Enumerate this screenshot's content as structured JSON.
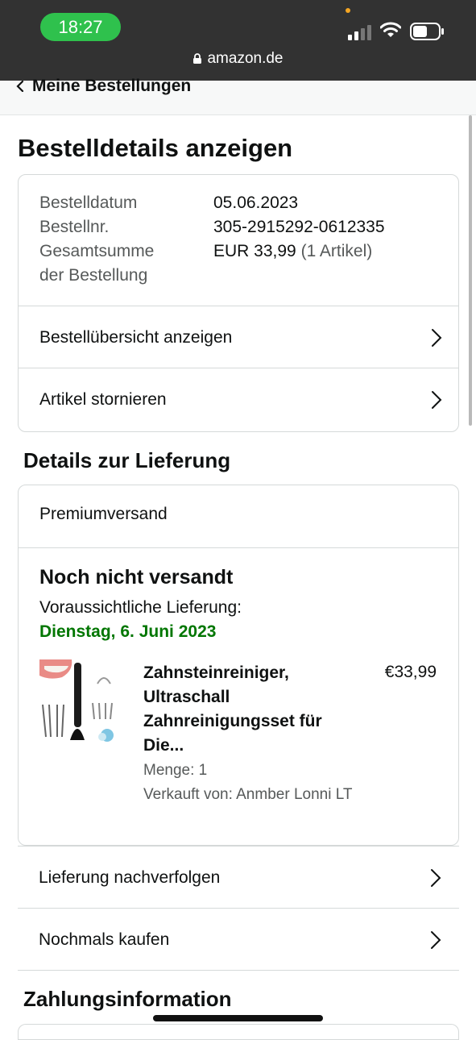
{
  "status": {
    "time": "18:27",
    "url": "amazon.de"
  },
  "nav": {
    "back_label": "Meine Bestellungen"
  },
  "page": {
    "title": "Bestelldetails anzeigen"
  },
  "order": {
    "date_label": "Bestelldatum",
    "date": "05.06.2023",
    "number_label": "Bestellnr.",
    "number": "305-2915292-0612335",
    "total_label_line1": "Gesamtsumme",
    "total_label_line2": "der Bestellung",
    "total": "EUR 33,99",
    "total_items": "(1 Artikel)",
    "links": [
      {
        "label": "Bestellübersicht anzeigen"
      },
      {
        "label": "Artikel stornieren"
      }
    ]
  },
  "delivery": {
    "heading": "Details zur Lieferung",
    "shipping_method": "Premiumversand",
    "status": "Noch nicht versandt",
    "expected_label": "Voraussichtliche Lieferung:",
    "expected_date": "Dienstag, 6. Juni 2023",
    "item": {
      "title_lines": [
        "Zahnsteinreiniger,",
        "Ultraschall",
        "Zahnreinigungsset für",
        "Die..."
      ],
      "price": "€33,99",
      "quantity": "Menge: 1",
      "seller": "Verkauft von: Anmber Lonni LT"
    },
    "actions": [
      {
        "label": "Lieferung nachverfolgen"
      },
      {
        "label": "Nochmals kaufen"
      }
    ]
  },
  "payment": {
    "heading": "Zahlungsinformation"
  },
  "colors": {
    "status_bar": "#323232",
    "time_pill": "#2fc14d",
    "delivery_date": "#007600",
    "border": "#d5d9d9"
  }
}
